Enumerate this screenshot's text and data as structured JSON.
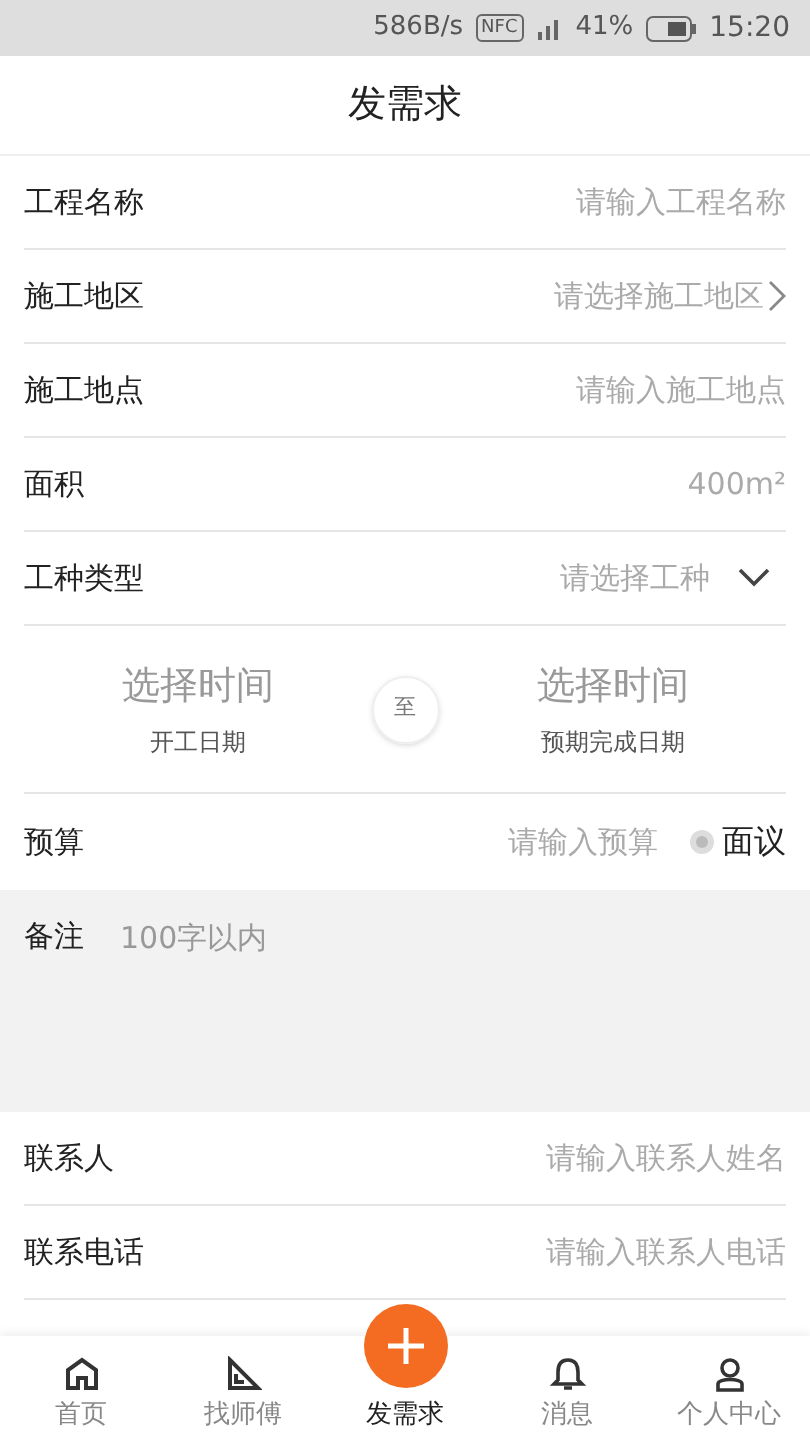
{
  "status_bar": {
    "speed": "586B/s",
    "nfc": "NFC",
    "battery": "41%",
    "time": "15:20"
  },
  "title": "发需求",
  "fields": [
    {
      "kind": "input",
      "label": "工程名称",
      "placeholder": "请输入工程名称"
    },
    {
      "kind": "select",
      "label": "施工地区",
      "placeholder": "请选择施工地区"
    },
    {
      "kind": "input",
      "label": "施工地点",
      "placeholder": "请输入施工地点"
    },
    {
      "kind": "unit",
      "label": "面积",
      "placeholder": "400",
      "unit": "m²"
    },
    {
      "kind": "dropdown",
      "label": "工种类型",
      "placeholder": "请选择工种"
    }
  ],
  "dates": {
    "start": {
      "value": "选择时间",
      "caption": "开工日期"
    },
    "separator": "至",
    "end": {
      "value": "选择时间",
      "caption": "预期完成日期"
    }
  },
  "budget": {
    "label": "预算",
    "placeholder": "请输入预算",
    "option": "面议",
    "checked": false
  },
  "remark": {
    "label": "备注",
    "placeholder": "100字以内"
  },
  "contacts": [
    {
      "label": "联系人",
      "placeholder": "请输入联系人姓名"
    },
    {
      "label": "联系电话",
      "placeholder": "请输入联系人电话"
    }
  ],
  "nav": [
    {
      "kind": "home",
      "label": "首页",
      "selected": false
    },
    {
      "kind": "ruler",
      "label": "找师傅",
      "selected": false
    },
    {
      "kind": "plus",
      "label": "发需求",
      "selected": true
    },
    {
      "kind": "bell",
      "label": "消息",
      "selected": false
    },
    {
      "kind": "user",
      "label": "个人中心",
      "selected": false
    }
  ]
}
